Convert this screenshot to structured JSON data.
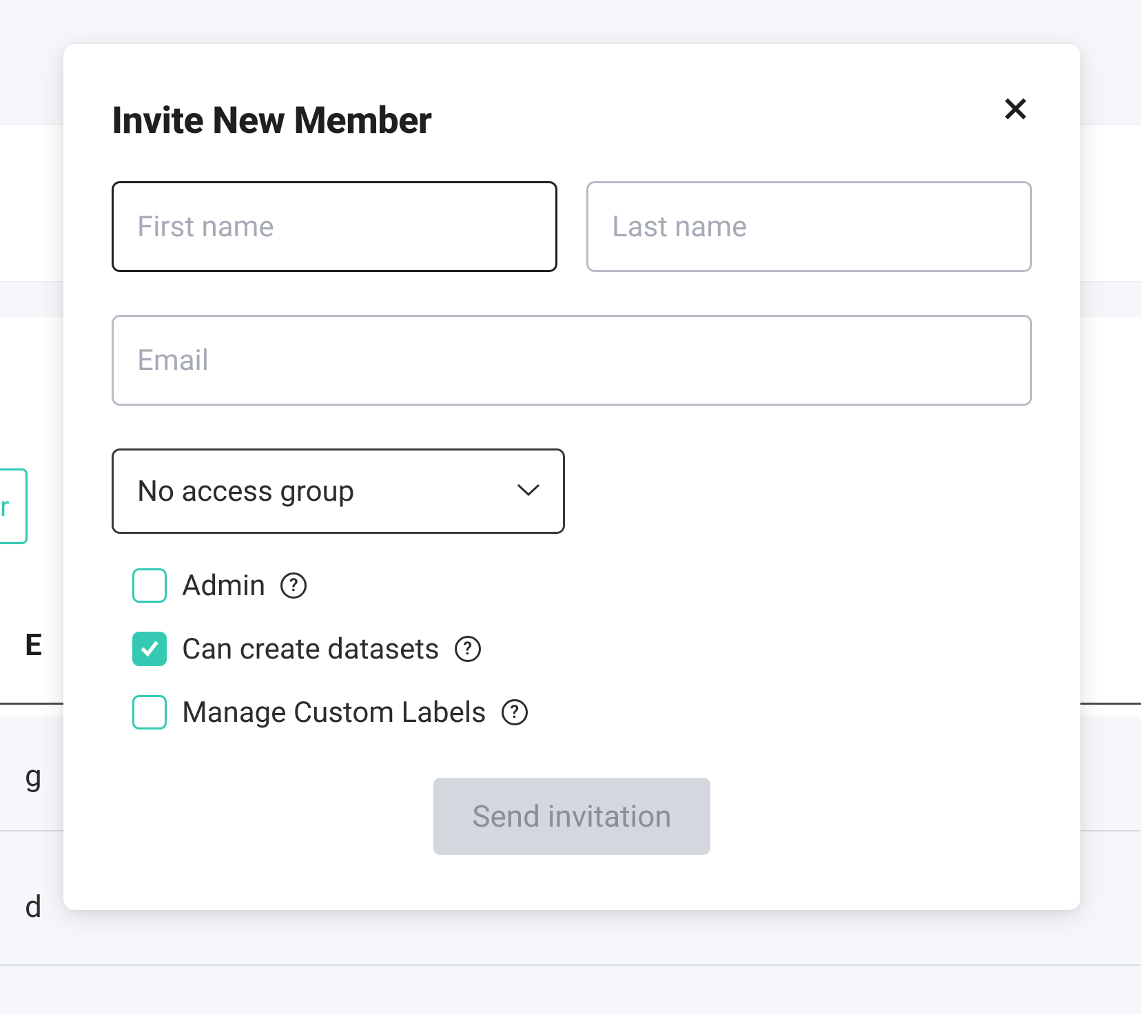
{
  "background": {
    "tab_fragment": "r",
    "column_header_fragment": "E",
    "row1_fragment": "g",
    "row2_fragment": "d"
  },
  "modal": {
    "title": "Invite New Member",
    "close_icon": "close",
    "first_name": {
      "placeholder": "First name",
      "value": ""
    },
    "last_name": {
      "placeholder": "Last name",
      "value": ""
    },
    "email": {
      "placeholder": "Email",
      "value": ""
    },
    "access_group": {
      "selected": "No access group"
    },
    "permissions": [
      {
        "label": "Admin",
        "checked": false,
        "help": "?"
      },
      {
        "label": "Can create datasets",
        "checked": true,
        "help": "?"
      },
      {
        "label": "Manage Custom Labels",
        "checked": false,
        "help": "?"
      }
    ],
    "submit_label": "Send invitation"
  }
}
